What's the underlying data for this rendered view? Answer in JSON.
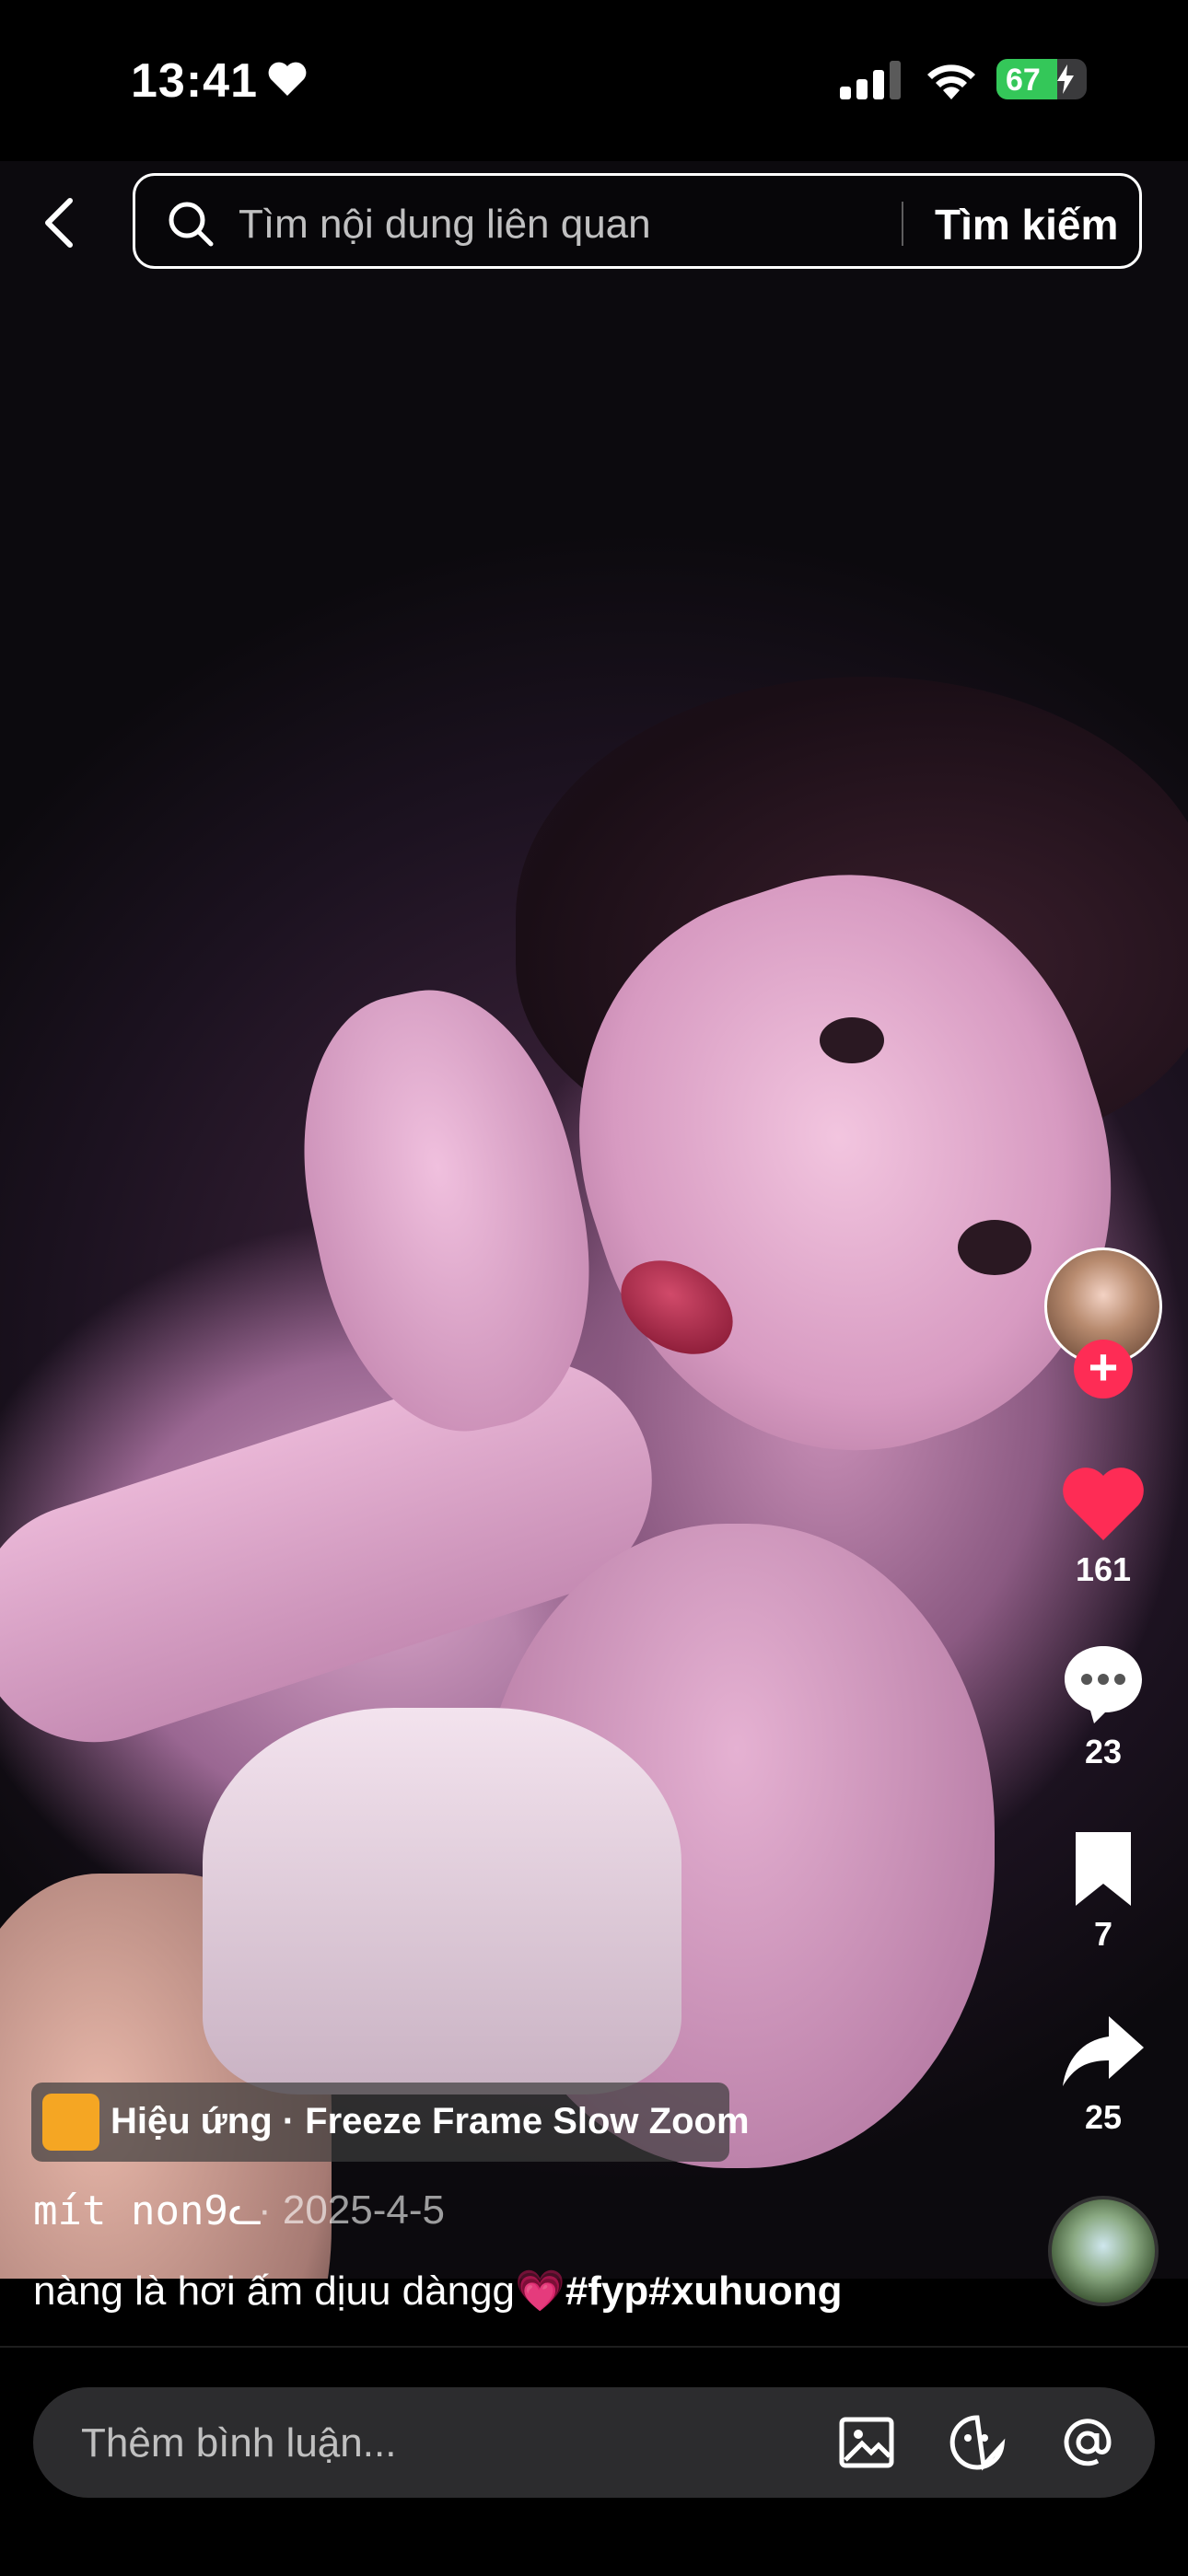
{
  "status_bar": {
    "time": "13:41",
    "battery": "67",
    "battery_level": 0.67
  },
  "search": {
    "placeholder": "Tìm nội dung liên quan",
    "button": "Tìm kiếm"
  },
  "rail": {
    "likes": "161",
    "comments": "23",
    "saves": "7",
    "shares": "25",
    "follow_symbol": "+"
  },
  "effect": {
    "label": "Hiệu ứng · Freeze Frame Slow Zoom"
  },
  "post": {
    "author": "mít non9ᓚ",
    "date": "· 2025-4-5",
    "caption_text": "nàng là hơi ấm dịuu dàngg",
    "caption_emoji": "💗",
    "caption_tags": "#fyp#xuhuong"
  },
  "comment": {
    "placeholder": "Thêm bình luận..."
  },
  "colors": {
    "accent_red": "#fe2c55",
    "battery_green": "#34c759"
  },
  "icons": [
    "heart-icon",
    "signal-icon",
    "wifi-icon",
    "battery-icon",
    "back-icon",
    "search-icon",
    "like-icon",
    "comment-icon",
    "bookmark-icon",
    "share-icon",
    "image-icon",
    "sticker-icon",
    "mention-icon"
  ]
}
